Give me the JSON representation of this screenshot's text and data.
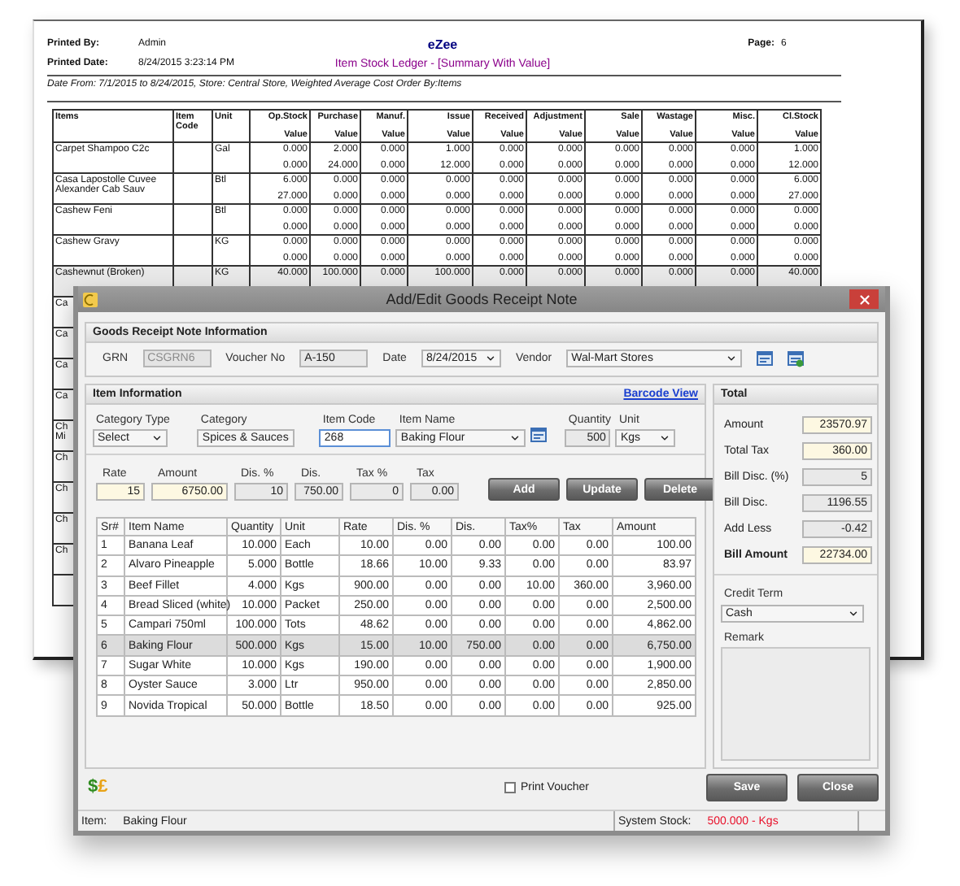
{
  "report": {
    "printed_by_label": "Printed By:",
    "printed_by": "Admin",
    "printed_date_label": "Printed Date:",
    "printed_date": "8/24/2015 3:23:14 PM",
    "company": "eZee",
    "title": "Item Stock Ledger - [Summary With Value]",
    "page_label": "Page:",
    "page": "6",
    "criteria": "Date From: 7/1/2015 to 8/24/2015, Store: Central Store, Weighted Average Cost Order By:Items",
    "columns": [
      {
        "label": "Items"
      },
      {
        "label": "Item Code"
      },
      {
        "label": "Unit"
      },
      {
        "label": "Op.Stock",
        "sub": "Value"
      },
      {
        "label": "Purchase",
        "sub": "Value"
      },
      {
        "label": "Manuf.",
        "sub": "Value"
      },
      {
        "label": "Issue",
        "sub": "Value"
      },
      {
        "label": "Received",
        "sub": "Value"
      },
      {
        "label": "Adjustment",
        "sub": "Value"
      },
      {
        "label": "Sale",
        "sub": "Value"
      },
      {
        "label": "Wastage",
        "sub": "Value"
      },
      {
        "label": "Misc.",
        "sub": "Value"
      },
      {
        "label": "Cl.Stock",
        "sub": "Value"
      }
    ],
    "rows": [
      {
        "item": "Carpet Shampoo C2c",
        "unit": "Gal",
        "highlighted": false,
        "line1": [
          "0.000",
          "2.000",
          "0.000",
          "1.000",
          "0.000",
          "0.000",
          "0.000",
          "0.000",
          "0.000",
          "1.000"
        ],
        "line2": [
          "0.000",
          "24.000",
          "0.000",
          "12.000",
          "0.000",
          "0.000",
          "0.000",
          "0.000",
          "0.000",
          "12.000"
        ]
      },
      {
        "item": "Casa Lapostolle Cuvee Alexander Cab Sauv",
        "unit": "Btl",
        "highlighted": false,
        "line1": [
          "6.000",
          "0.000",
          "0.000",
          "0.000",
          "0.000",
          "0.000",
          "0.000",
          "0.000",
          "0.000",
          "6.000"
        ],
        "line2": [
          "27.000",
          "0.000",
          "0.000",
          "0.000",
          "0.000",
          "0.000",
          "0.000",
          "0.000",
          "0.000",
          "27.000"
        ]
      },
      {
        "item": "Cashew Feni",
        "unit": "Btl",
        "highlighted": false,
        "line1": [
          "0.000",
          "0.000",
          "0.000",
          "0.000",
          "0.000",
          "0.000",
          "0.000",
          "0.000",
          "0.000",
          "0.000"
        ],
        "line2": [
          "0.000",
          "0.000",
          "0.000",
          "0.000",
          "0.000",
          "0.000",
          "0.000",
          "0.000",
          "0.000",
          "0.000"
        ]
      },
      {
        "item": "Cashew Gravy",
        "unit": "KG",
        "highlighted": false,
        "line1": [
          "0.000",
          "0.000",
          "0.000",
          "0.000",
          "0.000",
          "0.000",
          "0.000",
          "0.000",
          "0.000",
          "0.000"
        ],
        "line2": [
          "0.000",
          "0.000",
          "0.000",
          "0.000",
          "0.000",
          "0.000",
          "0.000",
          "0.000",
          "0.000",
          "0.000"
        ]
      },
      {
        "item": "Cashewnut (Broken)",
        "unit": "KG",
        "highlighted": true,
        "line1": [
          "40.000",
          "100.000",
          "0.000",
          "100.000",
          "0.000",
          "0.000",
          "0.000",
          "0.000",
          "0.000",
          "40.000"
        ]
      },
      {
        "item": "Ca",
        "highlighted": false
      },
      {
        "item": "Ca",
        "highlighted": false
      },
      {
        "item": "Ca",
        "highlighted": false
      },
      {
        "item": "Ca",
        "highlighted": false
      },
      {
        "item": "Ch Mi",
        "highlighted": false
      },
      {
        "item": "Ch",
        "highlighted": false
      },
      {
        "item": "Ch",
        "highlighted": false
      },
      {
        "item": "Ch",
        "highlighted": false
      },
      {
        "item": "Ch",
        "highlighted": false
      },
      {
        "highlighted": false
      }
    ]
  },
  "dialog": {
    "title": "Add/Edit Goods Receipt Note",
    "grn_section": {
      "heading": "Goods Receipt Note Information",
      "fields": [
        {
          "label": "GRN",
          "value": "CSGRN6",
          "kind": "disabled"
        },
        {
          "label": "Voucher No",
          "value": "A-150",
          "kind": "readonly"
        },
        {
          "label": "Date",
          "value": "8/24/2015",
          "kind": "select"
        },
        {
          "label": "Vendor",
          "value": "Wal-Mart Stores",
          "kind": "select"
        }
      ]
    },
    "item_section": {
      "heading": "Item Information",
      "link": "Barcode View",
      "fields": [
        {
          "label": "Category Type",
          "value": "Select",
          "kind": "select"
        },
        {
          "label": "Category",
          "value": "Spices & Sauces",
          "kind": "select"
        },
        {
          "label": "Item Code",
          "value": "268",
          "kind": "focused"
        },
        {
          "label": "Item Name",
          "value": "Baking Flour",
          "kind": "select"
        },
        {
          "label": "Quantity",
          "value": "500",
          "kind": "readonly"
        },
        {
          "label": "Unit",
          "value": "Kgs",
          "kind": "select"
        }
      ],
      "entry_fields": [
        {
          "label": "Rate",
          "value": "15",
          "kind": "highlight"
        },
        {
          "label": "Amount",
          "value": "6750.00",
          "kind": "highlight"
        },
        {
          "label": "Dis. %",
          "value": "10",
          "kind": "readonly"
        },
        {
          "label": "Dis.",
          "value": "750.00",
          "kind": "readonly"
        },
        {
          "label": "Tax %",
          "value": "0",
          "kind": "readonly"
        },
        {
          "label": "Tax",
          "value": "0.00",
          "kind": "readonly"
        }
      ],
      "buttons": [
        "Add",
        "Update",
        "Delete"
      ]
    },
    "grid": {
      "columns": [
        "Sr#",
        "Item Name",
        "Quantity",
        "Unit",
        "Rate",
        "Dis. %",
        "Dis.",
        "Tax%",
        "Tax",
        "Amount"
      ],
      "rows": [
        {
          "selected": false,
          "cells": [
            "1",
            "Banana Leaf",
            "10.000",
            "Each",
            "10.00",
            "0.00",
            "0.00",
            "0.00",
            "0.00",
            "100.00"
          ]
        },
        {
          "selected": false,
          "cells": [
            "2",
            "Alvaro  Pineapple",
            "5.000",
            "Bottle",
            "18.66",
            "10.00",
            "9.33",
            "0.00",
            "0.00",
            "83.97"
          ]
        },
        {
          "selected": false,
          "cells": [
            "3",
            "Beef Fillet",
            "4.000",
            "Kgs",
            "900.00",
            "0.00",
            "0.00",
            "10.00",
            "360.00",
            "3,960.00"
          ]
        },
        {
          "selected": false,
          "cells": [
            "4",
            "Bread Sliced (white)",
            "10.000",
            "Packet",
            "250.00",
            "0.00",
            "0.00",
            "0.00",
            "0.00",
            "2,500.00"
          ]
        },
        {
          "selected": false,
          "cells": [
            "5",
            "Campari 750ml",
            "100.000",
            "Tots",
            "48.62",
            "0.00",
            "0.00",
            "0.00",
            "0.00",
            "4,862.00"
          ]
        },
        {
          "selected": true,
          "cells": [
            "6",
            "Baking Flour",
            "500.000",
            "Kgs",
            "15.00",
            "10.00",
            "750.00",
            "0.00",
            "0.00",
            "6,750.00"
          ]
        },
        {
          "selected": false,
          "cells": [
            "7",
            "Sugar White",
            "10.000",
            "Kgs",
            "190.00",
            "0.00",
            "0.00",
            "0.00",
            "0.00",
            "1,900.00"
          ]
        },
        {
          "selected": false,
          "cells": [
            "8",
            "Oyster Sauce",
            "3.000",
            "Ltr",
            "950.00",
            "0.00",
            "0.00",
            "0.00",
            "0.00",
            "2,850.00"
          ]
        },
        {
          "selected": false,
          "cells": [
            "9",
            "Novida Tropical",
            "50.000",
            "Bottle",
            "18.50",
            "0.00",
            "0.00",
            "0.00",
            "0.00",
            "925.00"
          ]
        }
      ]
    },
    "totals": {
      "heading": "Total",
      "rows": [
        {
          "label": "Amount",
          "value": "23570.97",
          "kind": "highlight",
          "bold": false
        },
        {
          "label": "Total Tax",
          "value": "360.00",
          "kind": "highlight",
          "bold": false
        },
        {
          "label": "Bill Disc. (%)",
          "value": "5",
          "kind": "readonly",
          "bold": false
        },
        {
          "label": "Bill Disc.",
          "value": "1196.55",
          "kind": "readonly",
          "bold": false
        },
        {
          "label": "Add Less",
          "value": "-0.42",
          "kind": "readonly",
          "bold": false
        },
        {
          "label": "Bill Amount",
          "value": "22734.00",
          "kind": "highlight",
          "bold": true
        }
      ],
      "credit_term_label": "Credit Term",
      "credit_term": "Cash",
      "remark_label": "Remark"
    },
    "currency_symbols": [
      {
        "symbol": "$",
        "color": "#2e8b1e"
      },
      {
        "symbol": "£",
        "color": "#e8a317"
      }
    ],
    "print_voucher": {
      "label": "Print Voucher",
      "checked": false
    },
    "buttons": [
      "Save",
      "Close"
    ],
    "status": {
      "item_label": "Item:",
      "item": "Baking Flour",
      "stock_label": "System Stock:",
      "stock": "500.000 - Kgs"
    }
  }
}
